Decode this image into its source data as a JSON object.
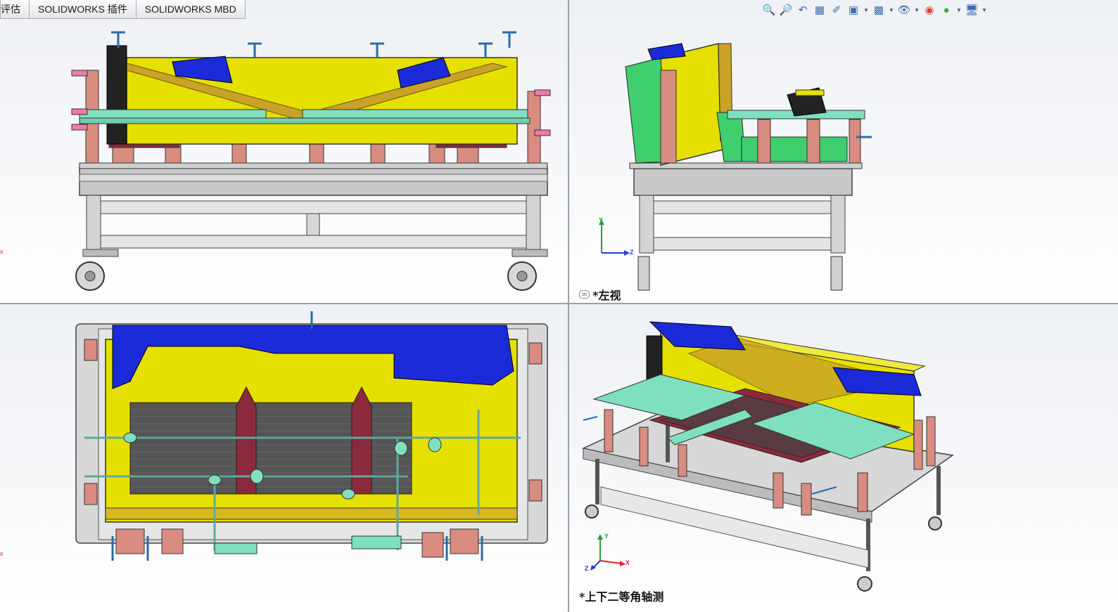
{
  "command_manager": {
    "tabs": [
      {
        "label": "评估"
      },
      {
        "label": "SOLIDWORKS 插件"
      },
      {
        "label": "SOLIDWORKS MBD"
      }
    ]
  },
  "heads_up_toolbar": {
    "icons": [
      "zoom-to-fit-icon",
      "zoom-to-area-icon",
      "previous-view-icon",
      "section-view-icon",
      "dynamic-annotation-icon",
      "view-orientation-icon",
      "display-style-icon",
      "hide-show-items-icon",
      "edit-appearance-icon",
      "apply-scene-icon",
      "view-settings-icon"
    ]
  },
  "viewports": {
    "top_left": {
      "axis_marker": "x"
    },
    "top_right": {
      "label": "*左视",
      "triad": {
        "y": "Y",
        "z": "Z"
      }
    },
    "bottom_left": {
      "axis_marker": "x"
    },
    "bottom_right": {
      "label": "*上下二等角轴测",
      "triad": {
        "y": "Y",
        "z": "Z",
        "x": "X"
      }
    }
  },
  "colors": {
    "yellow": "#e6e000",
    "blue": "#1a2ad8",
    "green": "#3fcf6e",
    "mint": "#7fe0c0",
    "salmon": "#d98c80",
    "maroon": "#8a2a3a",
    "grey": "#c8c8c8",
    "dark": "#222222"
  }
}
